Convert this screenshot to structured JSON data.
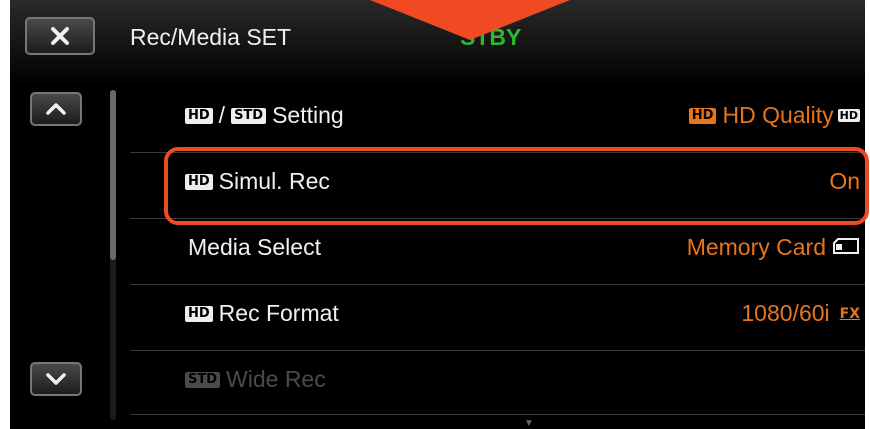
{
  "header": {
    "title": "Rec/Media SET",
    "status": "STBY"
  },
  "menu": {
    "rows": [
      {
        "tag1": "HD",
        "slash": "/",
        "tag2": "STD",
        "label": "Setting",
        "value_tag": "HD",
        "value": "HD Quality",
        "value_icon": "HD"
      },
      {
        "tag1": "HD",
        "label": "Simul. Rec",
        "value": "On"
      },
      {
        "label": "Media Select",
        "value": "Memory Card"
      },
      {
        "tag1": "HD",
        "label": "Rec Format",
        "value": "1080/60i",
        "value_suffix": "FX"
      },
      {
        "tag1": "STD",
        "label": "Wide Rec",
        "value": ""
      }
    ]
  },
  "colors": {
    "accent_orange": "#e8751a",
    "status_green": "#2fb82f",
    "highlight_red": "#f04a23"
  },
  "icons": {
    "close": "close-icon",
    "up": "chevron-up-icon",
    "down": "chevron-down-icon",
    "memory_card": "memory-card-icon"
  }
}
